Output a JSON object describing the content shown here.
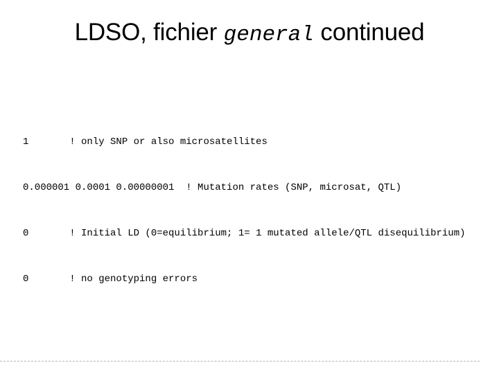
{
  "slide": {
    "title": {
      "before": "LDSO, fichier ",
      "mono": "general",
      "after": " continued"
    },
    "code_lines": [
      "1       ! only SNP or also microsatellites",
      "0.000001 0.0001 0.00000001  ! Mutation rates (SNP, microsat, QTL)",
      "0       ! Initial LD (0=equilibrium; 1= 1 mutated allele/QTL disequilibrium)",
      "0       ! no genotyping errors"
    ],
    "colors": {
      "background": "#ffffff",
      "text": "#000000",
      "rule": "#b3b3b3"
    }
  }
}
